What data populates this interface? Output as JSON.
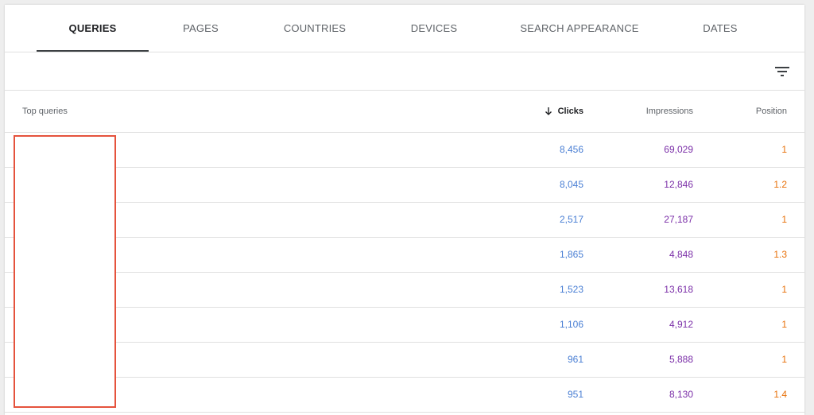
{
  "tabs": [
    {
      "label": "QUERIES",
      "active": true
    },
    {
      "label": "PAGES",
      "active": false
    },
    {
      "label": "COUNTRIES",
      "active": false
    },
    {
      "label": "DEVICES",
      "active": false
    },
    {
      "label": "SEARCH APPEARANCE",
      "active": false
    },
    {
      "label": "DATES",
      "active": false
    }
  ],
  "filter_icon": "filter-list-icon",
  "table": {
    "headers": {
      "query": "Top queries",
      "clicks": "Clicks",
      "impressions": "Impressions",
      "position": "Position"
    },
    "sort_icon": "arrow-down-icon",
    "rows": [
      {
        "query": "",
        "clicks": "8,456",
        "impressions": "69,029",
        "position": "1"
      },
      {
        "query": "",
        "clicks": "8,045",
        "impressions": "12,846",
        "position": "1.2"
      },
      {
        "query": "",
        "clicks": "2,517",
        "impressions": "27,187",
        "position": "1"
      },
      {
        "query": "",
        "clicks": "1,865",
        "impressions": "4,848",
        "position": "1.3"
      },
      {
        "query": "",
        "clicks": "1,523",
        "impressions": "13,618",
        "position": "1"
      },
      {
        "query": "",
        "clicks": "1,106",
        "impressions": "4,912",
        "position": "1"
      },
      {
        "query": "",
        "clicks": "961",
        "impressions": "5,888",
        "position": "1"
      },
      {
        "query": "",
        "clicks": "951",
        "impressions": "8,130",
        "position": "1.4"
      }
    ]
  },
  "colors": {
    "clicks": "#4a7fd4",
    "impressions": "#7b2fa8",
    "position": "#e8710a",
    "redaction_border": "#e5533d"
  }
}
